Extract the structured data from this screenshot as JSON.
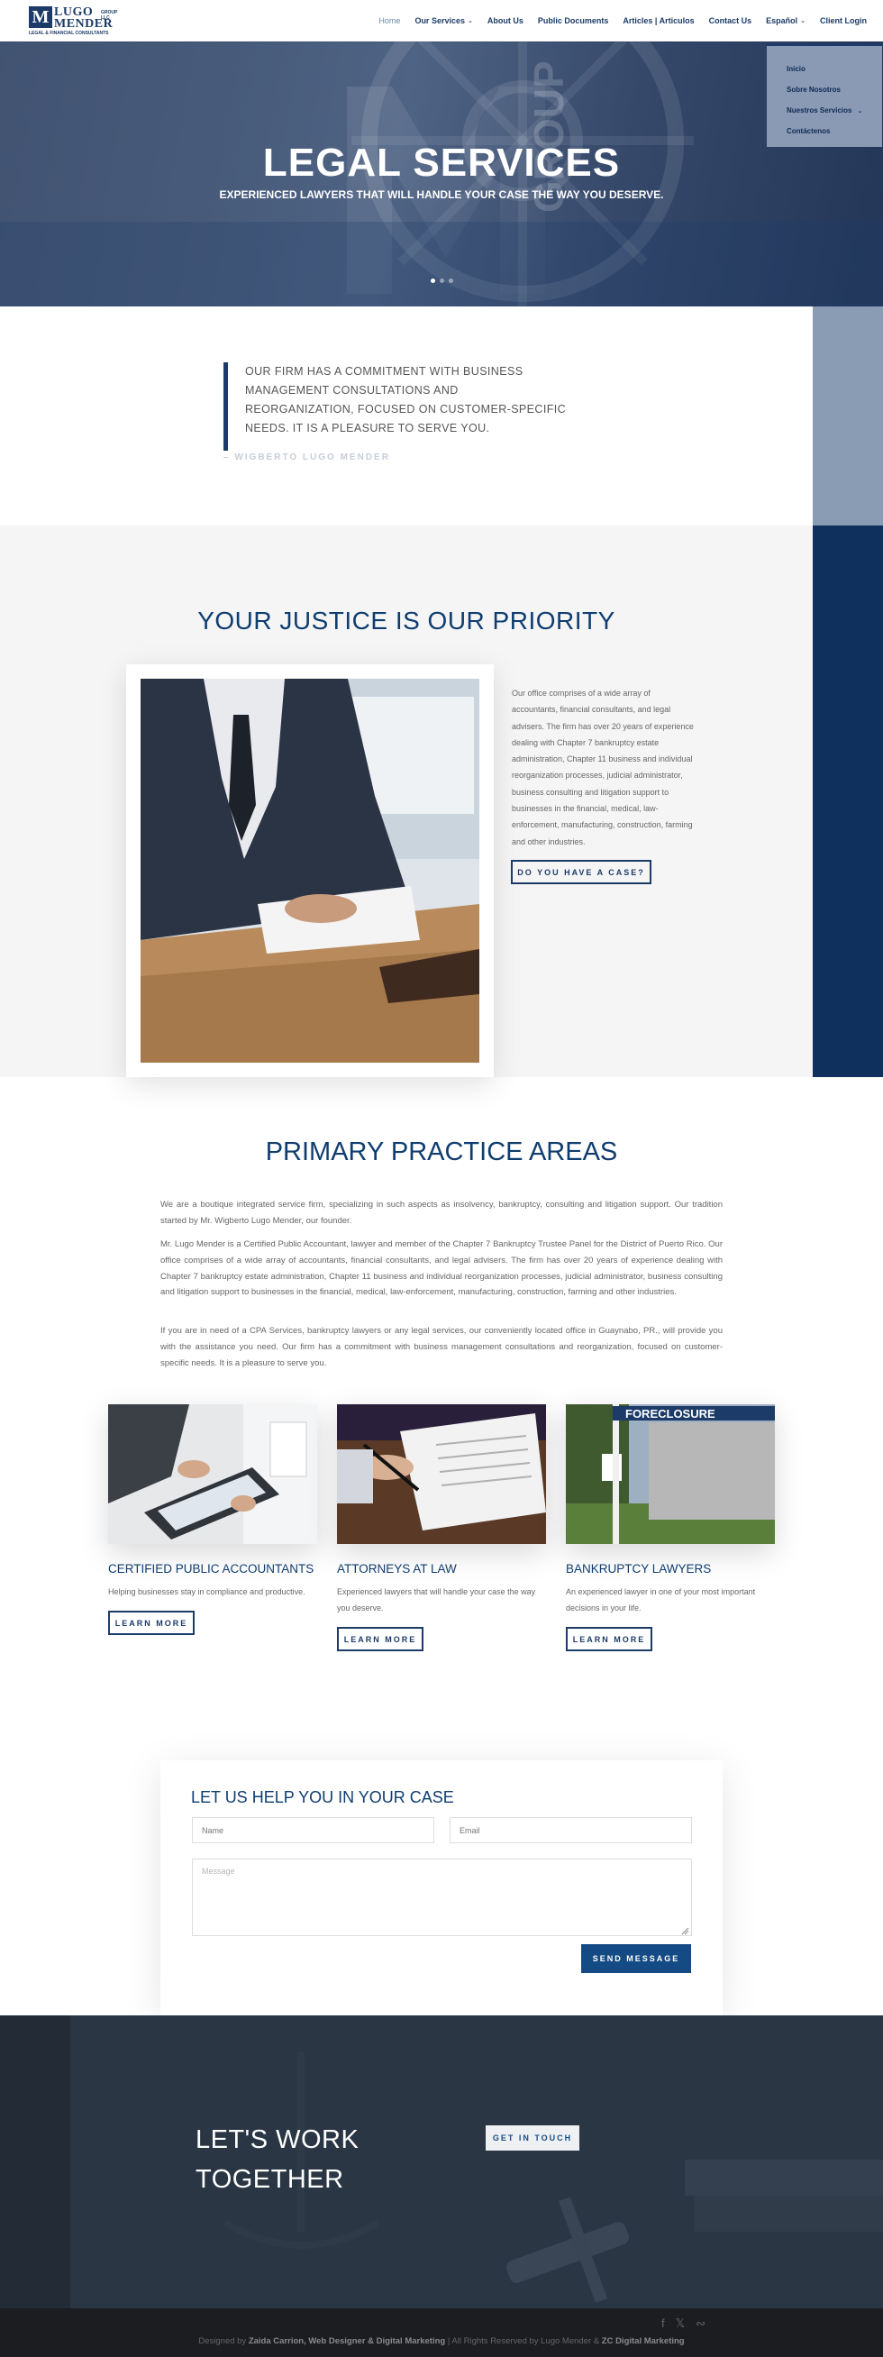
{
  "header": {
    "logo": {
      "line1": "LUGO",
      "line2": "MENDER",
      "group": "GROUP LLC",
      "tagline": "LEGAL & FINANCIAL CONSULTANTS"
    },
    "nav": [
      {
        "label": "Home"
      },
      {
        "label": "Our Services"
      },
      {
        "label": "About Us"
      },
      {
        "label": "Public Documents"
      },
      {
        "label": "Articles | Articulos"
      },
      {
        "label": "Contact Us"
      },
      {
        "label": "Español"
      },
      {
        "label": "Client Login"
      }
    ],
    "dropdown": [
      "Inicio",
      "Sobre Nosotros",
      "Nuestros Servicios",
      "Contáctenos"
    ]
  },
  "hero": {
    "title": "LEGAL SERVICES",
    "subtitle": "EXPERIENCED LAWYERS THAT WILL HANDLE YOUR CASE THE WAY YOU DESERVE.",
    "watermark": "GROUP"
  },
  "quote": {
    "text": "OUR FIRM HAS A COMMITMENT WITH BUSINESS MANAGEMENT CONSULTATIONS AND REORGANIZATION, FOCUSED ON CUSTOMER-SPECIFIC NEEDS. IT IS A PLEASURE TO SERVE YOU.",
    "author": "– WIGBERTO LUGO MENDER"
  },
  "justice": {
    "title": "YOUR JUSTICE IS OUR PRIORITY",
    "text": "Our office comprises of a wide array of accountants, financial consultants, and legal advisers. The firm has over 20 years of experience dealing with Chapter 7 bankruptcy estate administration, Chapter 11 business and individual reorganization processes, judicial administrator, business consulting and litigation support to businesses in the financial, medical, law-enforcement, manufacturing, construction, farming and other industries.",
    "button": "DO YOU HAVE A CASE?"
  },
  "practice": {
    "title": "PRIMARY PRACTICE AREAS",
    "paragraphs": [
      "We are a boutique integrated service firm, specializing in such aspects as insolvency, bankruptcy, consulting and litigation support. Our tradition started by Mr. Wigberto Lugo Mender, our founder.",
      "Mr. Lugo Mender is a Certified Public Accountant, lawyer and member of the Chapter 7 Bankruptcy Trustee Panel for the District of Puerto Rico.   Our office comprises of a wide array of accountants, financial consultants, and legal advisers. The firm has over 20 years of experience dealing with Chapter 7 bankruptcy estate administration, Chapter 11 business and individual reorganization processes, judicial administrator, business consulting and litigation support to businesses in the financial, medical, law-enforcement, manufacturing, construction, farming and other industries.",
      "If you are in need of a CPA Services, bankruptcy lawyers or any legal services, our conveniently located office in Guaynabo, PR., will provide you with the assistance you need. Our firm has a commitment with business management consultations and reorganization, focused on customer-specific needs. It is a pleasure to serve you."
    ],
    "cards": [
      {
        "title": "CERTIFIED PUBLIC ACCOUNTANTS",
        "desc": "Helping businesses stay in compliance and productive.",
        "button": "LEARN MORE"
      },
      {
        "title": "ATTORNEYS AT LAW",
        "desc": "Experienced lawyers that will handle your case the way you deserve.",
        "button": "LEARN MORE"
      },
      {
        "title": "BANKRUPTCY LAWYERS",
        "desc": "An experienced lawyer in one of your most important decisions in your life.",
        "button": "LEARN MORE",
        "sign": "FORECLOSURE"
      }
    ]
  },
  "contact": {
    "title": "LET US HELP YOU IN YOUR CASE",
    "name_placeholder": "Name",
    "email_placeholder": "Email",
    "message_placeholder": "Message",
    "send": "SEND MESSAGE"
  },
  "work": {
    "line1": "LET'S WORK",
    "line2": "TOGETHER",
    "button": "GET IN TOUCH"
  },
  "footer": {
    "pre": "Designed by ",
    "designer": "Zaida Carrion, Web Designer & Digital Marketing",
    "mid": " | All Rights Reserved by Lugo Mender & ",
    "company": "ZC Digital Marketing"
  },
  "colors": {
    "brand_navy": "#1c3b68",
    "title_blue": "#0f3d70",
    "button_blue": "#154b85"
  }
}
